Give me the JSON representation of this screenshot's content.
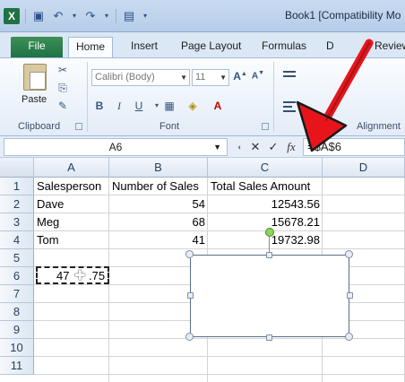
{
  "window": {
    "title": "Book1  [Compatibility Mo"
  },
  "tabs": [
    {
      "label": "File"
    },
    {
      "label": "Home"
    },
    {
      "label": "Insert"
    },
    {
      "label": "Page Layout"
    },
    {
      "label": "Formulas"
    },
    {
      "label": "D"
    },
    {
      "label": "Review"
    }
  ],
  "ribbon": {
    "paste_label": "Paste",
    "clipboard_label": "Clipboard",
    "font_label": "Font",
    "alignment_label": "Alignment",
    "font_name": "Calibri (Body)",
    "font_size": "11",
    "bold": "B",
    "italic": "I",
    "underline": "U"
  },
  "formula_bar": {
    "name_box": "A6",
    "fx": "fx",
    "formula": "=$A$6"
  },
  "sheet": {
    "columns": [
      "A",
      "B",
      "C",
      "D"
    ],
    "rows": [
      "1",
      "2",
      "3",
      "4",
      "5",
      "6",
      "7",
      "8",
      "9",
      "10",
      "11"
    ],
    "cells": {
      "A1": "Salesperson",
      "B1": "Number of Sales",
      "C1": "Total Sales Amount",
      "A2": "Dave",
      "B2": "54",
      "C2": "12543.56",
      "A3": "Meg",
      "B3": "68",
      "C3": "15678.21",
      "A4": "Tom",
      "B4": "41",
      "C4": "19732.98",
      "A6a": "47",
      "A6b": ".75"
    }
  },
  "colors": {
    "arrow": "#e8141b",
    "file_tab": "#1f7244",
    "rotate_handle": "#8cd45a"
  }
}
